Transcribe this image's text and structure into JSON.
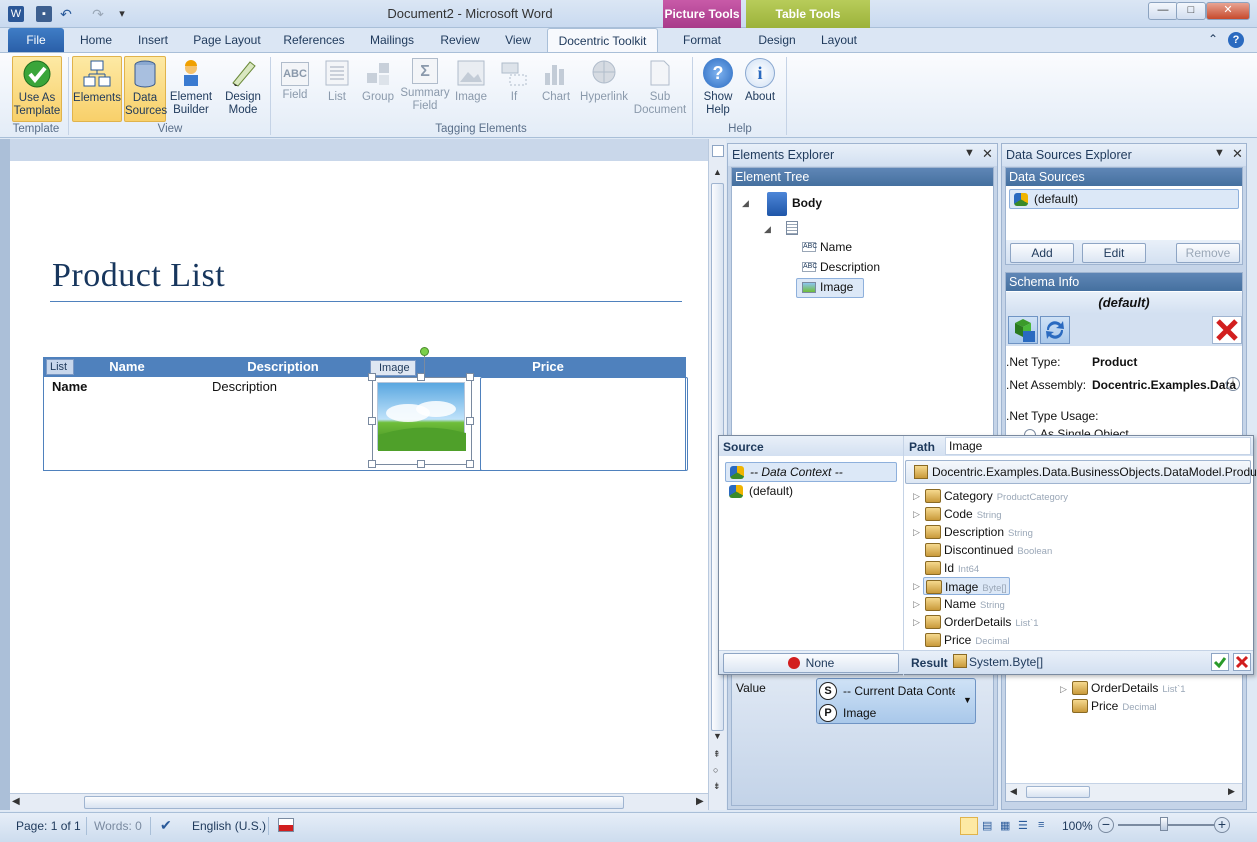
{
  "window": {
    "title": "Document2 - Microsoft Word",
    "context_tabs": {
      "picture_tools": "Picture Tools",
      "table_tools": "Table Tools"
    },
    "controls": {
      "minimize": "—",
      "maximize": "□",
      "close": "✕"
    }
  },
  "tabs": [
    {
      "label": "File"
    },
    {
      "label": "Home"
    },
    {
      "label": "Insert"
    },
    {
      "label": "Page Layout"
    },
    {
      "label": "References"
    },
    {
      "label": "Mailings"
    },
    {
      "label": "Review"
    },
    {
      "label": "View"
    },
    {
      "label": "Docentric Toolkit"
    },
    {
      "label": "Format"
    },
    {
      "label": "Design"
    },
    {
      "label": "Layout"
    }
  ],
  "ribbon": {
    "buttons": {
      "use_as_template": "Use As Template",
      "elements": "Elements",
      "data_sources": "Data Sources",
      "element_builder": "Element Builder",
      "design_mode": "Design Mode",
      "field": "Field",
      "list": "List",
      "group": "Group",
      "summary_field": "Summary Field",
      "image": "Image",
      "if": "If",
      "chart": "Chart",
      "hyperlink": "Hyperlink",
      "sub_document": "Sub Document",
      "show_help": "Show Help",
      "about": "About"
    },
    "groups": {
      "template": "Template",
      "view": "View",
      "tagging": "Tagging Elements",
      "help": "Help"
    },
    "icon_text": {
      "field": "ABC",
      "summary": "Σ",
      "help": "?",
      "about": "i"
    }
  },
  "document": {
    "title": "Product List",
    "table_headers": [
      "Name",
      "Description",
      "Image",
      "Price"
    ],
    "row": {
      "name": "Name",
      "description": "Description"
    },
    "list_tag": "List",
    "image_tag": "Image"
  },
  "elements_explorer": {
    "title": "Elements Explorer",
    "tree_header": "Element Tree",
    "tree": {
      "body": "Body",
      "name": "Name",
      "description": "Description",
      "image": "Image"
    },
    "value_label": "Value",
    "value_source": "-- Current Data Contex",
    "value_path": "Image",
    "s_badge": "S",
    "p_badge": "P"
  },
  "data_sources_explorer": {
    "title": "Data Sources Explorer",
    "sources_header": "Data Sources",
    "source_item": "(default)",
    "add": "Add",
    "edit": "Edit",
    "remove": "Remove",
    "schema_header": "Schema Info",
    "schema_title": "(default)",
    "net_type_label": ".Net Type:",
    "net_type_value": "Product",
    "net_assembly_label": ".Net Assembly:",
    "net_assembly_value": "Docentric.Examples.Data",
    "usage_label": ".Net Type Usage:",
    "usage_option": "As Single Object",
    "lower_tree": [
      {
        "name": "OrderDetails",
        "type": "List`1"
      },
      {
        "name": "Price",
        "type": "Decimal"
      }
    ]
  },
  "binding_popup": {
    "source_header": "Source",
    "path_header": "Path",
    "path_value": "Image",
    "sources": [
      "-- Data Context --",
      "(default)"
    ],
    "type_name": "Docentric.Examples.Data.BusinessObjects.DataModel.Product",
    "properties": [
      {
        "name": "Category",
        "type": "ProductCategory",
        "expandable": true
      },
      {
        "name": "Code",
        "type": "String",
        "expandable": true
      },
      {
        "name": "Description",
        "type": "String",
        "expandable": true
      },
      {
        "name": "Discontinued",
        "type": "Boolean",
        "expandable": false
      },
      {
        "name": "Id",
        "type": "Int64",
        "expandable": false
      },
      {
        "name": "Image",
        "type": "Byte[]",
        "expandable": true
      },
      {
        "name": "Name",
        "type": "String",
        "expandable": true
      },
      {
        "name": "OrderDetails",
        "type": "List`1",
        "expandable": true
      },
      {
        "name": "Price",
        "type": "Decimal",
        "expandable": false
      }
    ],
    "none_label": "None",
    "result_label": "Result",
    "result_value": "System.Byte[]"
  },
  "statusbar": {
    "page": "Page: 1 of 1",
    "words": "Words: 0",
    "language": "English (U.S.)",
    "zoom": "100%"
  }
}
